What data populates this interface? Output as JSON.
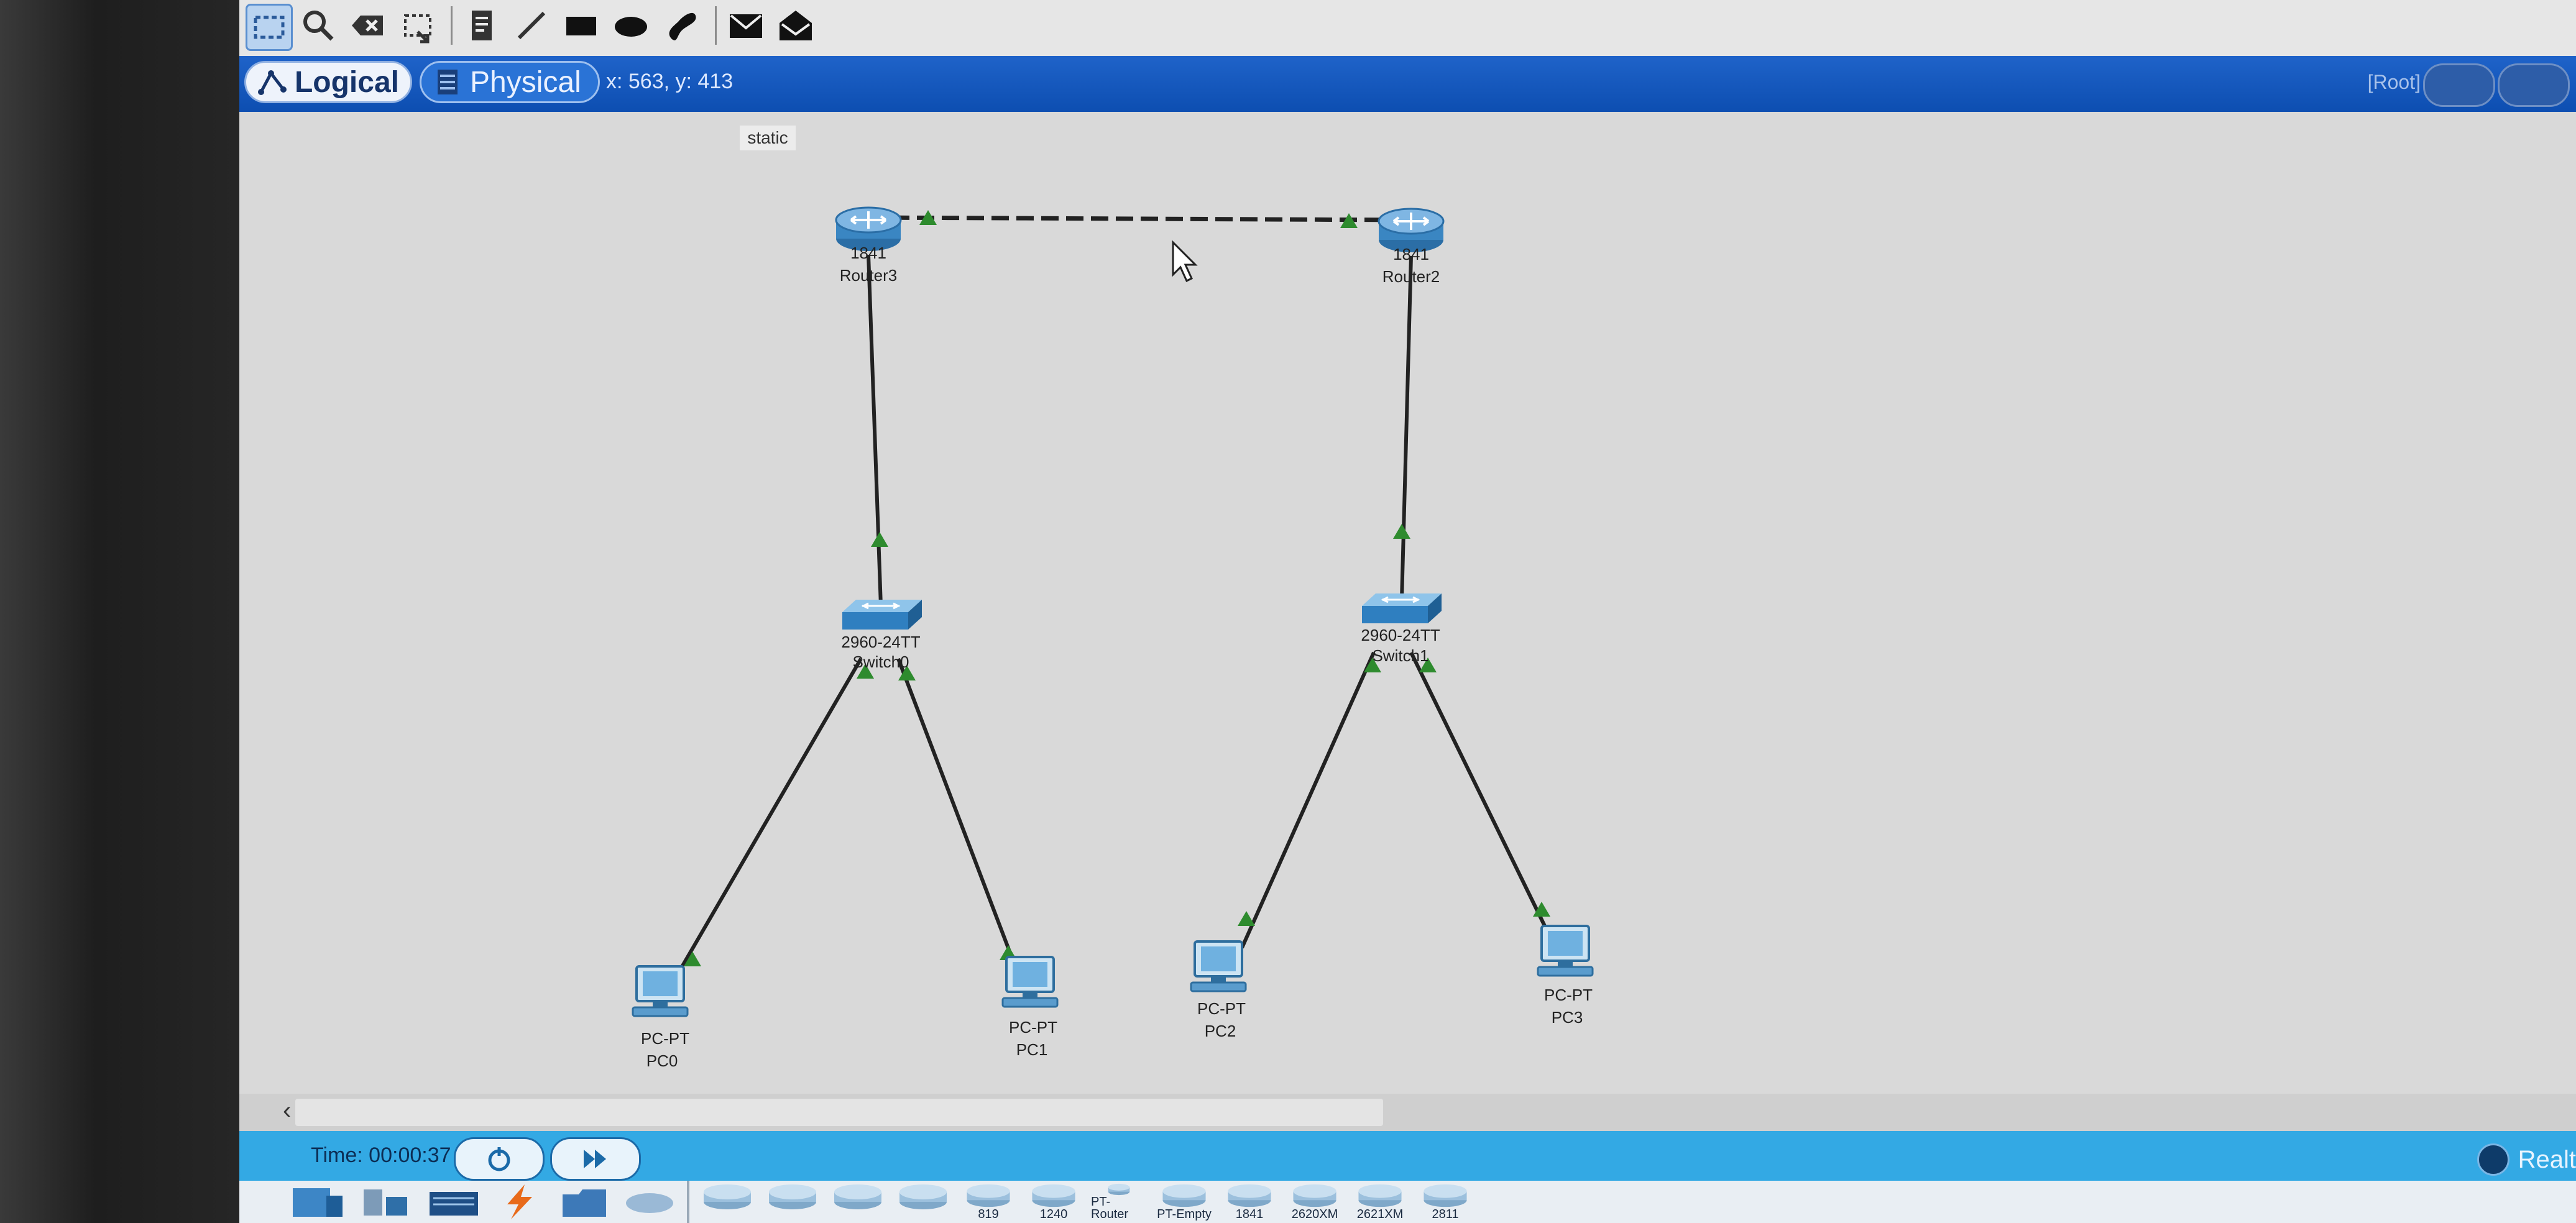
{
  "tabs": {
    "logical": "Logical",
    "physical": "Physical"
  },
  "coords": "x: 563, y: 413",
  "workspace_root": "[Root]",
  "canvas_label": "static",
  "devices": {
    "router3": {
      "model": "1841",
      "name": "Router3"
    },
    "router2": {
      "model": "1841",
      "name": "Router2"
    },
    "switch0": {
      "model": "2960-24TT",
      "name": "Switch0"
    },
    "switch1": {
      "model": "2960-24TT",
      "name": "Switch1"
    },
    "pc0": {
      "model": "PC-PT",
      "name": "PC0"
    },
    "pc1": {
      "model": "PC-PT",
      "name": "PC1"
    },
    "pc2": {
      "model": "PC-PT",
      "name": "PC2"
    },
    "pc3": {
      "model": "PC-PT",
      "name": "PC3"
    }
  },
  "time_label": "Time: 00:00:37",
  "realtime_label": "Realt",
  "device_palette": [
    "",
    "",
    "",
    "",
    "819",
    "1240",
    "PT-Router",
    "PT-Empty",
    "1841",
    "2620XM",
    "2621XM",
    "2811"
  ],
  "colors": {
    "link_up": "#2e8b2e",
    "mode_bar": "#1a5fc5",
    "time_bar": "#33a9e4"
  }
}
